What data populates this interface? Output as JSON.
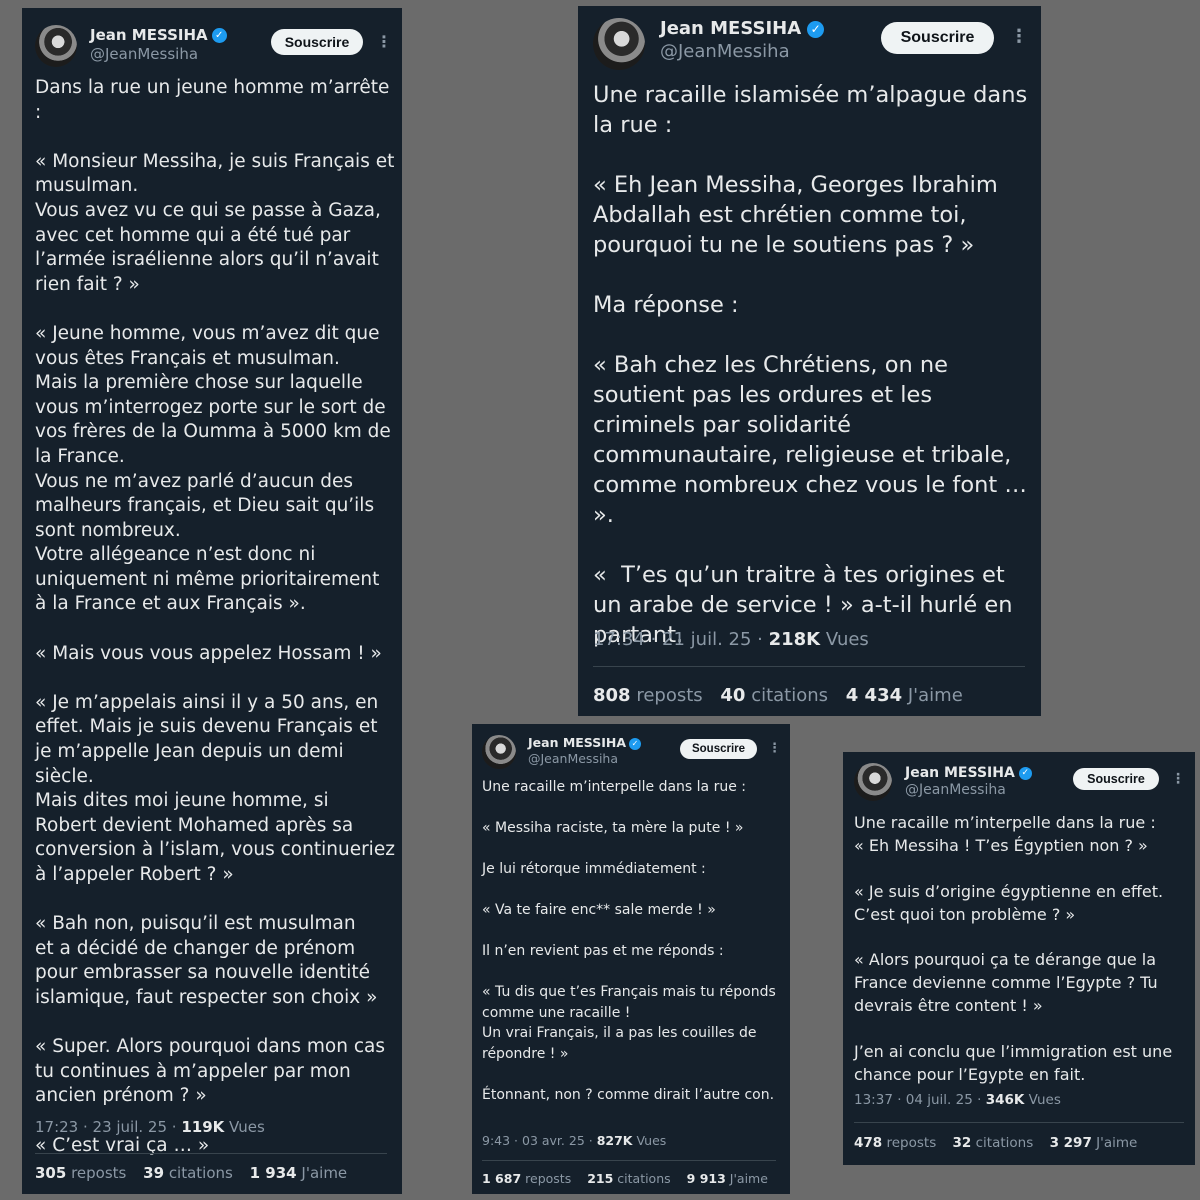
{
  "colors": {
    "background": "#6b6b6b",
    "card": "#15202b",
    "text": "#e7e9ea",
    "muted": "#8b98a5",
    "verified": "#1d9bf0",
    "button": "#eff3f4"
  },
  "author": {
    "name": "Jean MESSIHA",
    "handle": "@JeanMessiha",
    "verified_icon": "verified-badge-icon",
    "subscribe_label": "Souscrire",
    "more_icon": "more-vertical-icon"
  },
  "tweets": [
    {
      "text": "Dans la rue un jeune homme m’arrête :\n\n« Monsieur Messiha, je suis Français et musulman.\nVous avez vu ce qui se passe à Gaza, avec cet homme qui a été tué par l’armée israélienne alors qu’il n’avait rien fait ? »\n\n« Jeune homme, vous m’avez dit que vous êtes Français et musulman.\nMais la première chose sur laquelle vous m’interrogez porte sur le sort de vos frères de la Oumma à 5000 km de la France.\nVous ne m’avez parlé d’aucun des malheurs français, et Dieu sait qu’ils sont nombreux.\nVotre allégeance n’est donc ni uniquement ni même prioritairement à la France et aux Français ».\n\n« Mais vous vous appelez Hossam ! »\n\n« Je m’appelais ainsi il y a 50 ans, en effet. Mais je suis devenu Français et je m’appelle Jean depuis un demi siècle.\nMais dites moi jeune homme, si Robert devient Mohamed après sa conversion à l’islam, vous continueriez à l’appeler Robert ? »\n\n« Bah non, puisqu’il est musulman\net a décidé de changer de prénom\npour embrasser sa nouvelle identité islamique, faut respecter son choix »\n\n« Super. Alors pourquoi dans mon cas tu continues à m’appeler par mon ancien prénom ? »\n\n« C’est vrai ça … »",
      "time_date": "17:23 · 23 juil. 25 · ",
      "views": "119K",
      "views_label": " Vues",
      "reposts": "305",
      "reposts_label": "reposts",
      "quotes": "39",
      "quotes_label": "citations",
      "likes": "1 934",
      "likes_label": "J'aime"
    },
    {
      "text": "Une racaille islamisée m’alpague dans la rue :\n\n« Eh Jean Messiha, Georges Ibrahim Abdallah est chrétien comme toi, pourquoi tu ne le soutiens pas ? »\n\nMa réponse :\n\n« Bah chez les Chrétiens, on ne soutient pas les ordures et les criminels par solidarité communautaire, religieuse et tribale, comme nombreux chez vous le font … ».\n\n«  T’es qu’un traitre à tes origines et\nun arabe de service ! » a-t-il hurlé en partant.",
      "time_date": "17:34 · 21 juil. 25 · ",
      "views": "218K",
      "views_label": " Vues",
      "reposts": "808",
      "reposts_label": "reposts",
      "quotes": "40",
      "quotes_label": "citations",
      "likes": "4 434",
      "likes_label": "J'aime"
    },
    {
      "text": "Une racaille m’interpelle dans la rue :\n\n« Messiha raciste, ta mère la pute ! »\n\nJe lui rétorque immédiatement :\n\n« Va te faire enc** sale merde ! »\n\nIl n’en revient pas et me réponds :\n\n« Tu dis que t’es Français mais tu réponds comme une racaille !\nUn vrai Français, il a pas les couilles de répondre ! »\n\nÉtonnant, non ? comme dirait l’autre con.",
      "time_date": "9:43 · 03 avr. 25 · ",
      "views": "827K",
      "views_label": " Vues",
      "reposts": "1 687",
      "reposts_label": "reposts",
      "quotes": "215",
      "quotes_label": "citations",
      "likes": "9 913",
      "likes_label": "J'aime"
    },
    {
      "text": "Une racaille m’interpelle dans la rue :\n« Eh Messiha ! T’es Égyptien non ? »\n\n« Je suis d’origine égyptienne en effet. C’est quoi ton problème ? »\n\n« Alors pourquoi ça te dérange que la France devienne comme l’Egypte ? Tu devrais être content ! »\n\nJ’en ai conclu que l’immigration est une chance pour l’Egypte en fait.",
      "time_date": "13:37 · 04 juil. 25 · ",
      "views": "346K",
      "views_label": " Vues",
      "reposts": "478",
      "reposts_label": "reposts",
      "quotes": "32",
      "quotes_label": "citations",
      "likes": "3 297",
      "likes_label": "J'aime"
    }
  ]
}
